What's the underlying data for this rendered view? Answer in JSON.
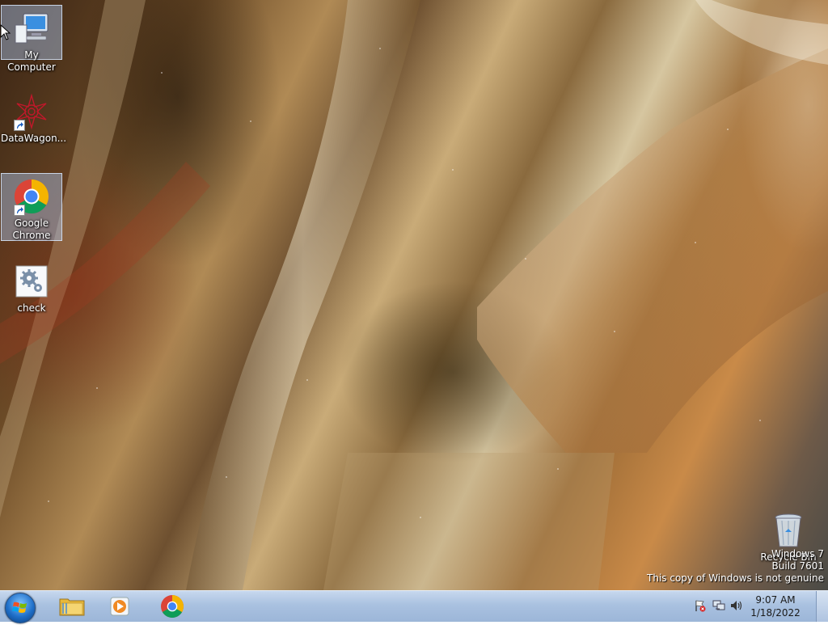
{
  "desktop": {
    "icons": [
      {
        "label": "My Computer"
      },
      {
        "label": "DataWagon..."
      },
      {
        "label_line1": "Google",
        "label_line2": "Chrome"
      },
      {
        "label": "check"
      },
      {
        "label": "Recycle Bin"
      }
    ]
  },
  "watermark": {
    "line1": "Windows 7",
    "line2": "Build 7601",
    "line3": "This copy of Windows is not genuine"
  },
  "taskbar": {
    "pinned": [
      "explorer-icon",
      "media-player-icon",
      "chrome-icon"
    ],
    "clock": {
      "time": "9:07 AM",
      "date": "1/18/2022"
    }
  },
  "colors": {
    "taskbar": "#a9c1e0",
    "start_orb": "#1f6fc9",
    "selection": "#aac8f0"
  }
}
